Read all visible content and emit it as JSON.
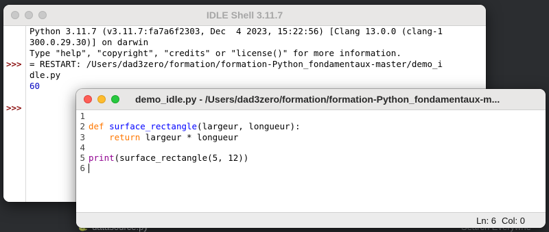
{
  "background": {
    "file_label": "datasource.py",
    "search_label": "Search Everywhe"
  },
  "shell": {
    "title": "IDLE Shell 3.11.7",
    "lines": [
      "Python 3.11.7 (v3.11.7:fa7a6f2303, Dec  4 2023, 15:22:56) [Clang 13.0.0 (clang-1",
      "300.0.29.30)] on darwin",
      "Type \"help\", \"copyright\", \"credits\" or \"license()\" for more information.",
      "",
      "= RESTART: /Users/dad3zero/formation/formation-Python_fondamentaux-master/demo_i",
      "dle.py"
    ],
    "output": "60",
    "prompt": ">>>"
  },
  "editor": {
    "title": "demo_idle.py - /Users/dad3zero/formation/formation-Python_fondamentaux-m...",
    "line_numbers": [
      "1",
      "2",
      "3",
      "4",
      "5",
      "6"
    ],
    "code": {
      "line2_kw": "def",
      "line2_name": "surface_rectangle",
      "line2_rest": "(largeur, longueur):",
      "line3_kw": "return",
      "line3_rest": " largeur * longueur",
      "line5_bi": "print",
      "line5_rest": "(surface_rectangle(5, 12))"
    },
    "status": {
      "line": "Ln: 6",
      "col": "Col: 0"
    }
  },
  "colors": {
    "prompt": "#8b1010",
    "keyword": "#ff7700",
    "definition": "#0000ff",
    "builtin": "#900090",
    "output": "#0000c0"
  }
}
